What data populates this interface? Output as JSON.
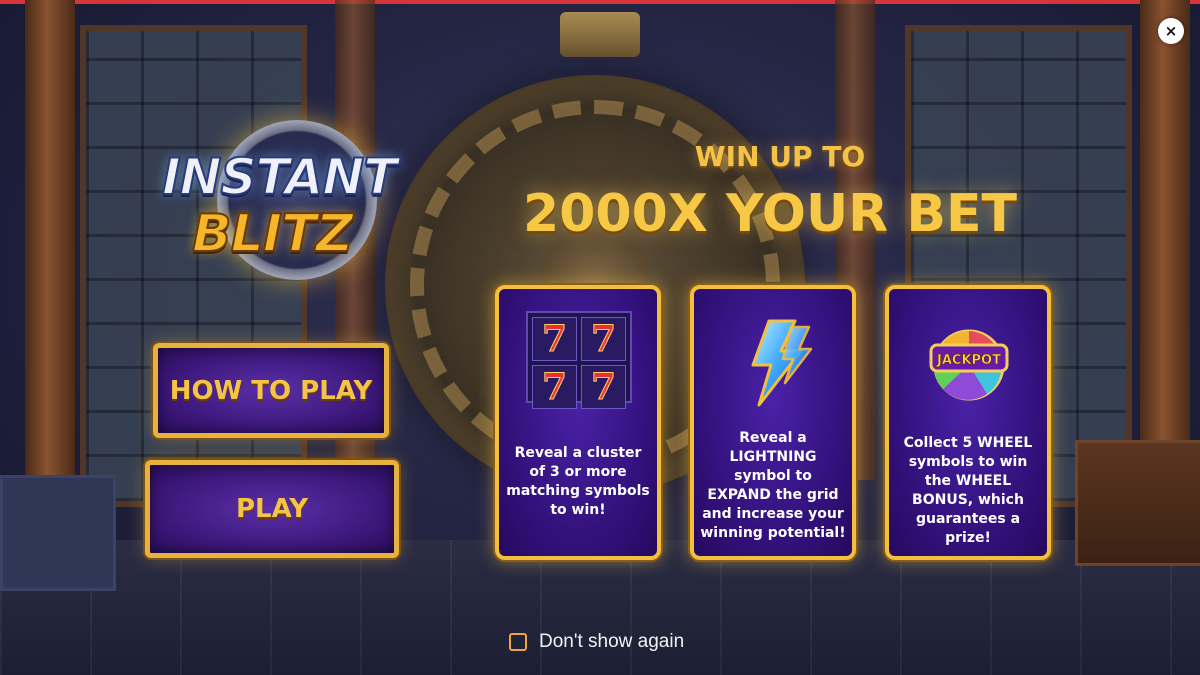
{
  "logo": {
    "line1": "INSTANT",
    "line2": "BLITZ",
    "description": "game-logo"
  },
  "headline": {
    "line1": "WIN UP TO",
    "line2": "2000X YOUR BET"
  },
  "buttons": {
    "how_to_play": "HOW TO PLAY",
    "play": "PLAY"
  },
  "cards": [
    {
      "icon": "sevens-icon",
      "symbols": [
        "7",
        "7",
        "7",
        "7"
      ],
      "text": "Reveal a cluster of 3 or more matching symbols to win!"
    },
    {
      "icon": "lightning-icon",
      "text": "Reveal a LIGHTNING symbol to EXPAND the grid and increase your winning potential!"
    },
    {
      "icon": "jackpot-wheel-icon",
      "badge": "JACKPOT",
      "text": "Collect 5 WHEEL symbols to win the WHEEL BONUS, which guarantees a prize!"
    }
  ],
  "footer": {
    "dont_show_again": "Don't show again",
    "checked": false
  },
  "close": {
    "label": "×"
  },
  "colors": {
    "gold": "#f3c247",
    "card_purple": "#34127e",
    "top_accent": "#d6363a",
    "checkbox_orange": "#f0a43a"
  }
}
